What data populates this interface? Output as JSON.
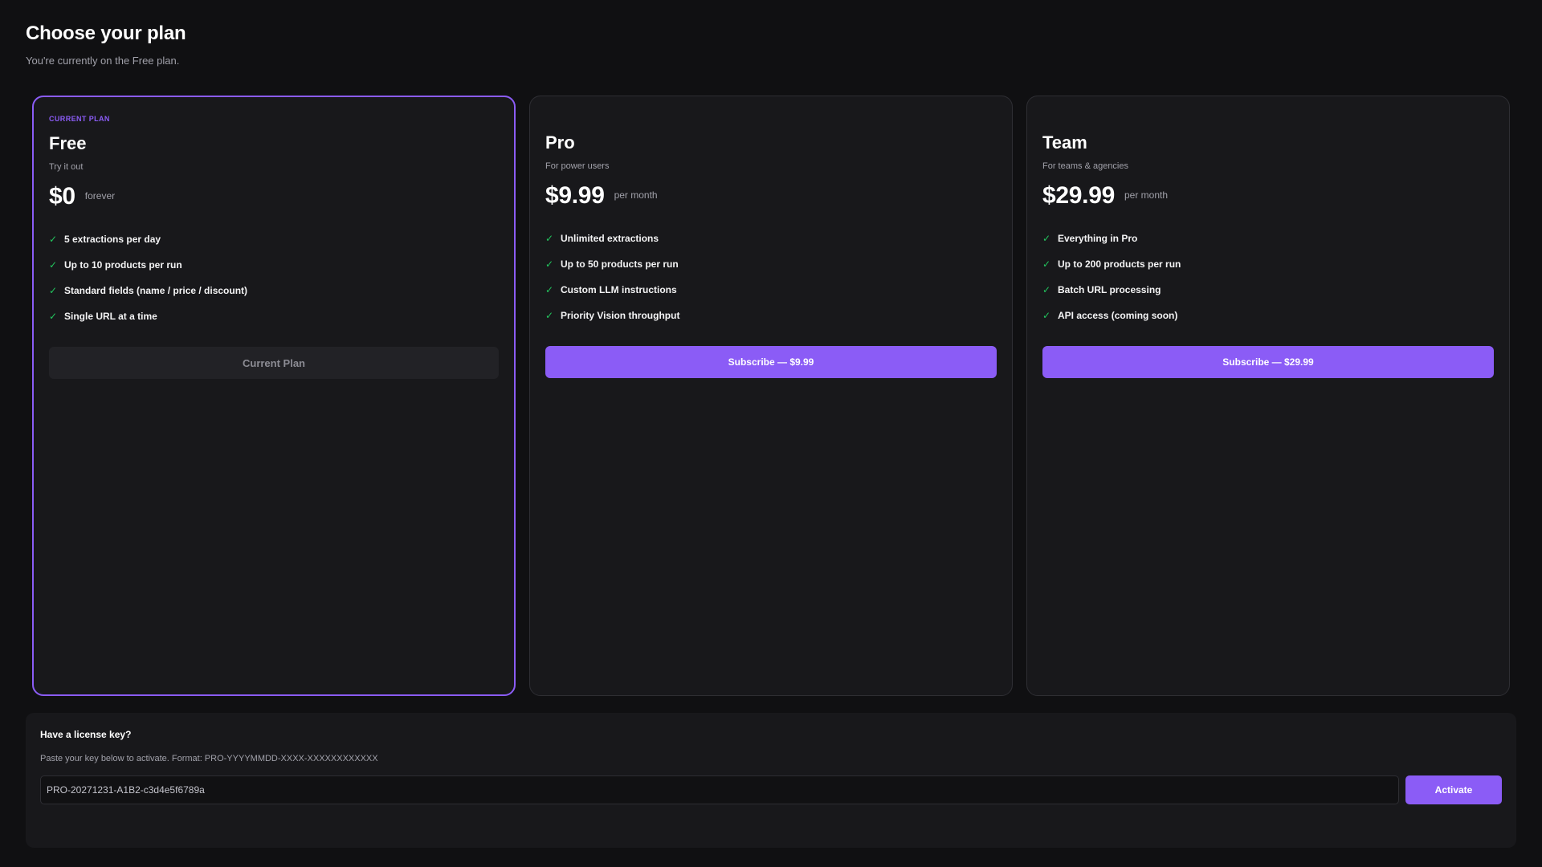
{
  "header": {
    "title": "Choose your plan",
    "subtitle": "You're currently on the Free plan."
  },
  "colors": {
    "accent": "#8b5cf6",
    "check": "#22c55e",
    "background": "#101012",
    "card": "#18181b"
  },
  "plans": [
    {
      "tag": "CURRENT PLAN",
      "name": "Free",
      "tagline": "Try it out",
      "price": "$0",
      "period": "forever",
      "features": [
        "5 extractions per day",
        "Up to 10 products per run",
        "Standard fields (name / price / discount)",
        "Single URL at a time"
      ],
      "button_label": "Current Plan",
      "current": true
    },
    {
      "tag": "",
      "name": "Pro",
      "tagline": "For power users",
      "price": "$9.99",
      "period": "per month",
      "features": [
        "Unlimited extractions",
        "Up to 50 products per run",
        "Custom LLM instructions",
        "Priority Vision throughput"
      ],
      "button_label": "Subscribe — $9.99",
      "current": false
    },
    {
      "tag": "",
      "name": "Team",
      "tagline": "For teams & agencies",
      "price": "$29.99",
      "period": "per month",
      "features": [
        "Everything in Pro",
        "Up to 200 products per run",
        "Batch URL processing",
        "API access (coming soon)"
      ],
      "button_label": "Subscribe — $29.99",
      "current": false
    }
  ],
  "icons": {
    "feature_check": "check-icon"
  },
  "license": {
    "title": "Have a license key?",
    "help": "Paste your key below to activate. Format: PRO-YYYYMMDD-XXXX-XXXXXXXXXXXX",
    "value": "PRO-20271231-A1B2-c3d4e5f6789a",
    "placeholder": "",
    "button_label": "Activate"
  }
}
